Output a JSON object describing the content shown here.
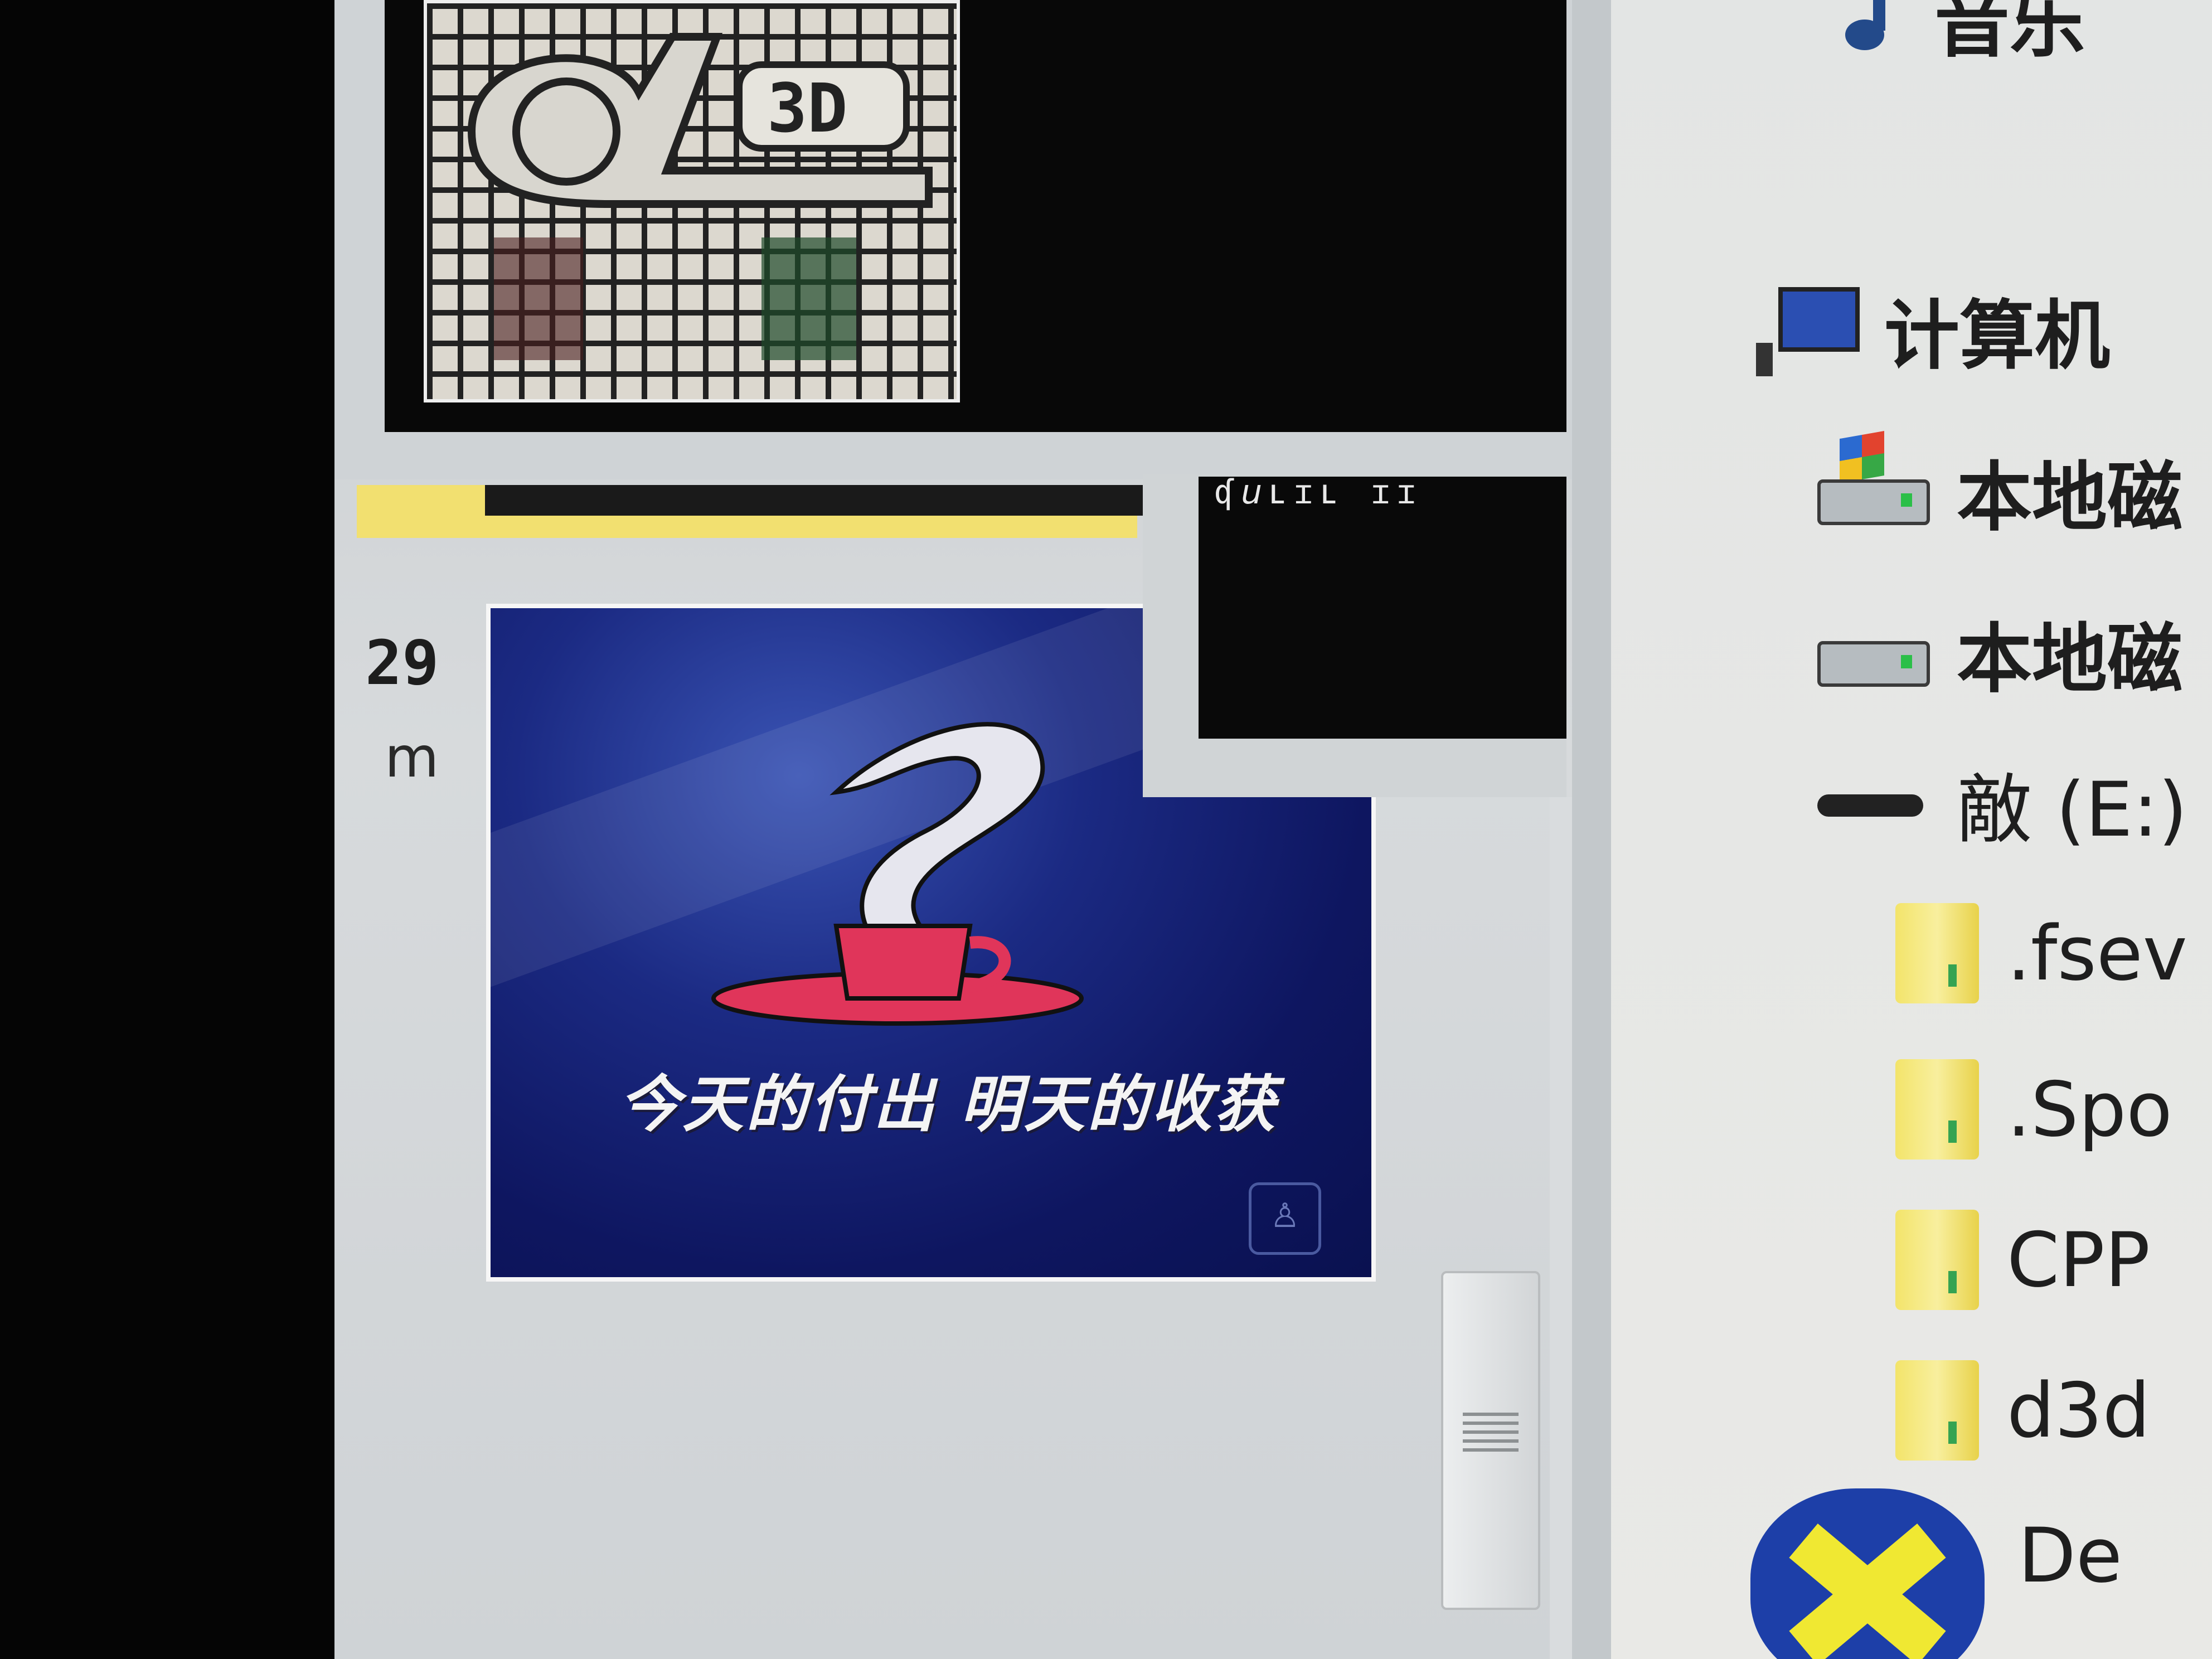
{
  "left_window": {
    "logo_text": "3D",
    "date_number": "29",
    "date_suffix": "m",
    "overlay_text": "ʠ𝘶ʟɪʟ   ɪɪ"
  },
  "wallpaper": {
    "caption": "今天的付出 明天的收获",
    "badge": "♙"
  },
  "explorer": {
    "items": [
      {
        "label": "音乐",
        "icon": "music-icon"
      },
      {
        "label": "计算机",
        "icon": "computer-icon"
      },
      {
        "label": "本地磁",
        "icon": "windows-drive-icon"
      },
      {
        "label": "本地磁",
        "icon": "drive-icon"
      },
      {
        "label": "敵 (E:)",
        "icon": "usb-drive-icon"
      },
      {
        "label": ".fsev",
        "icon": "folder-icon"
      },
      {
        "label": ".Spo",
        "icon": "folder-icon"
      },
      {
        "label": "CPP",
        "icon": "folder-icon"
      },
      {
        "label": "d3d",
        "icon": "folder-icon"
      },
      {
        "label": "De",
        "icon": "x-app-icon"
      }
    ]
  },
  "colors": {
    "wallpaper_blue": "#1b2a83",
    "cup_red": "#e0355a",
    "folder_yellow": "#f3e46a"
  }
}
